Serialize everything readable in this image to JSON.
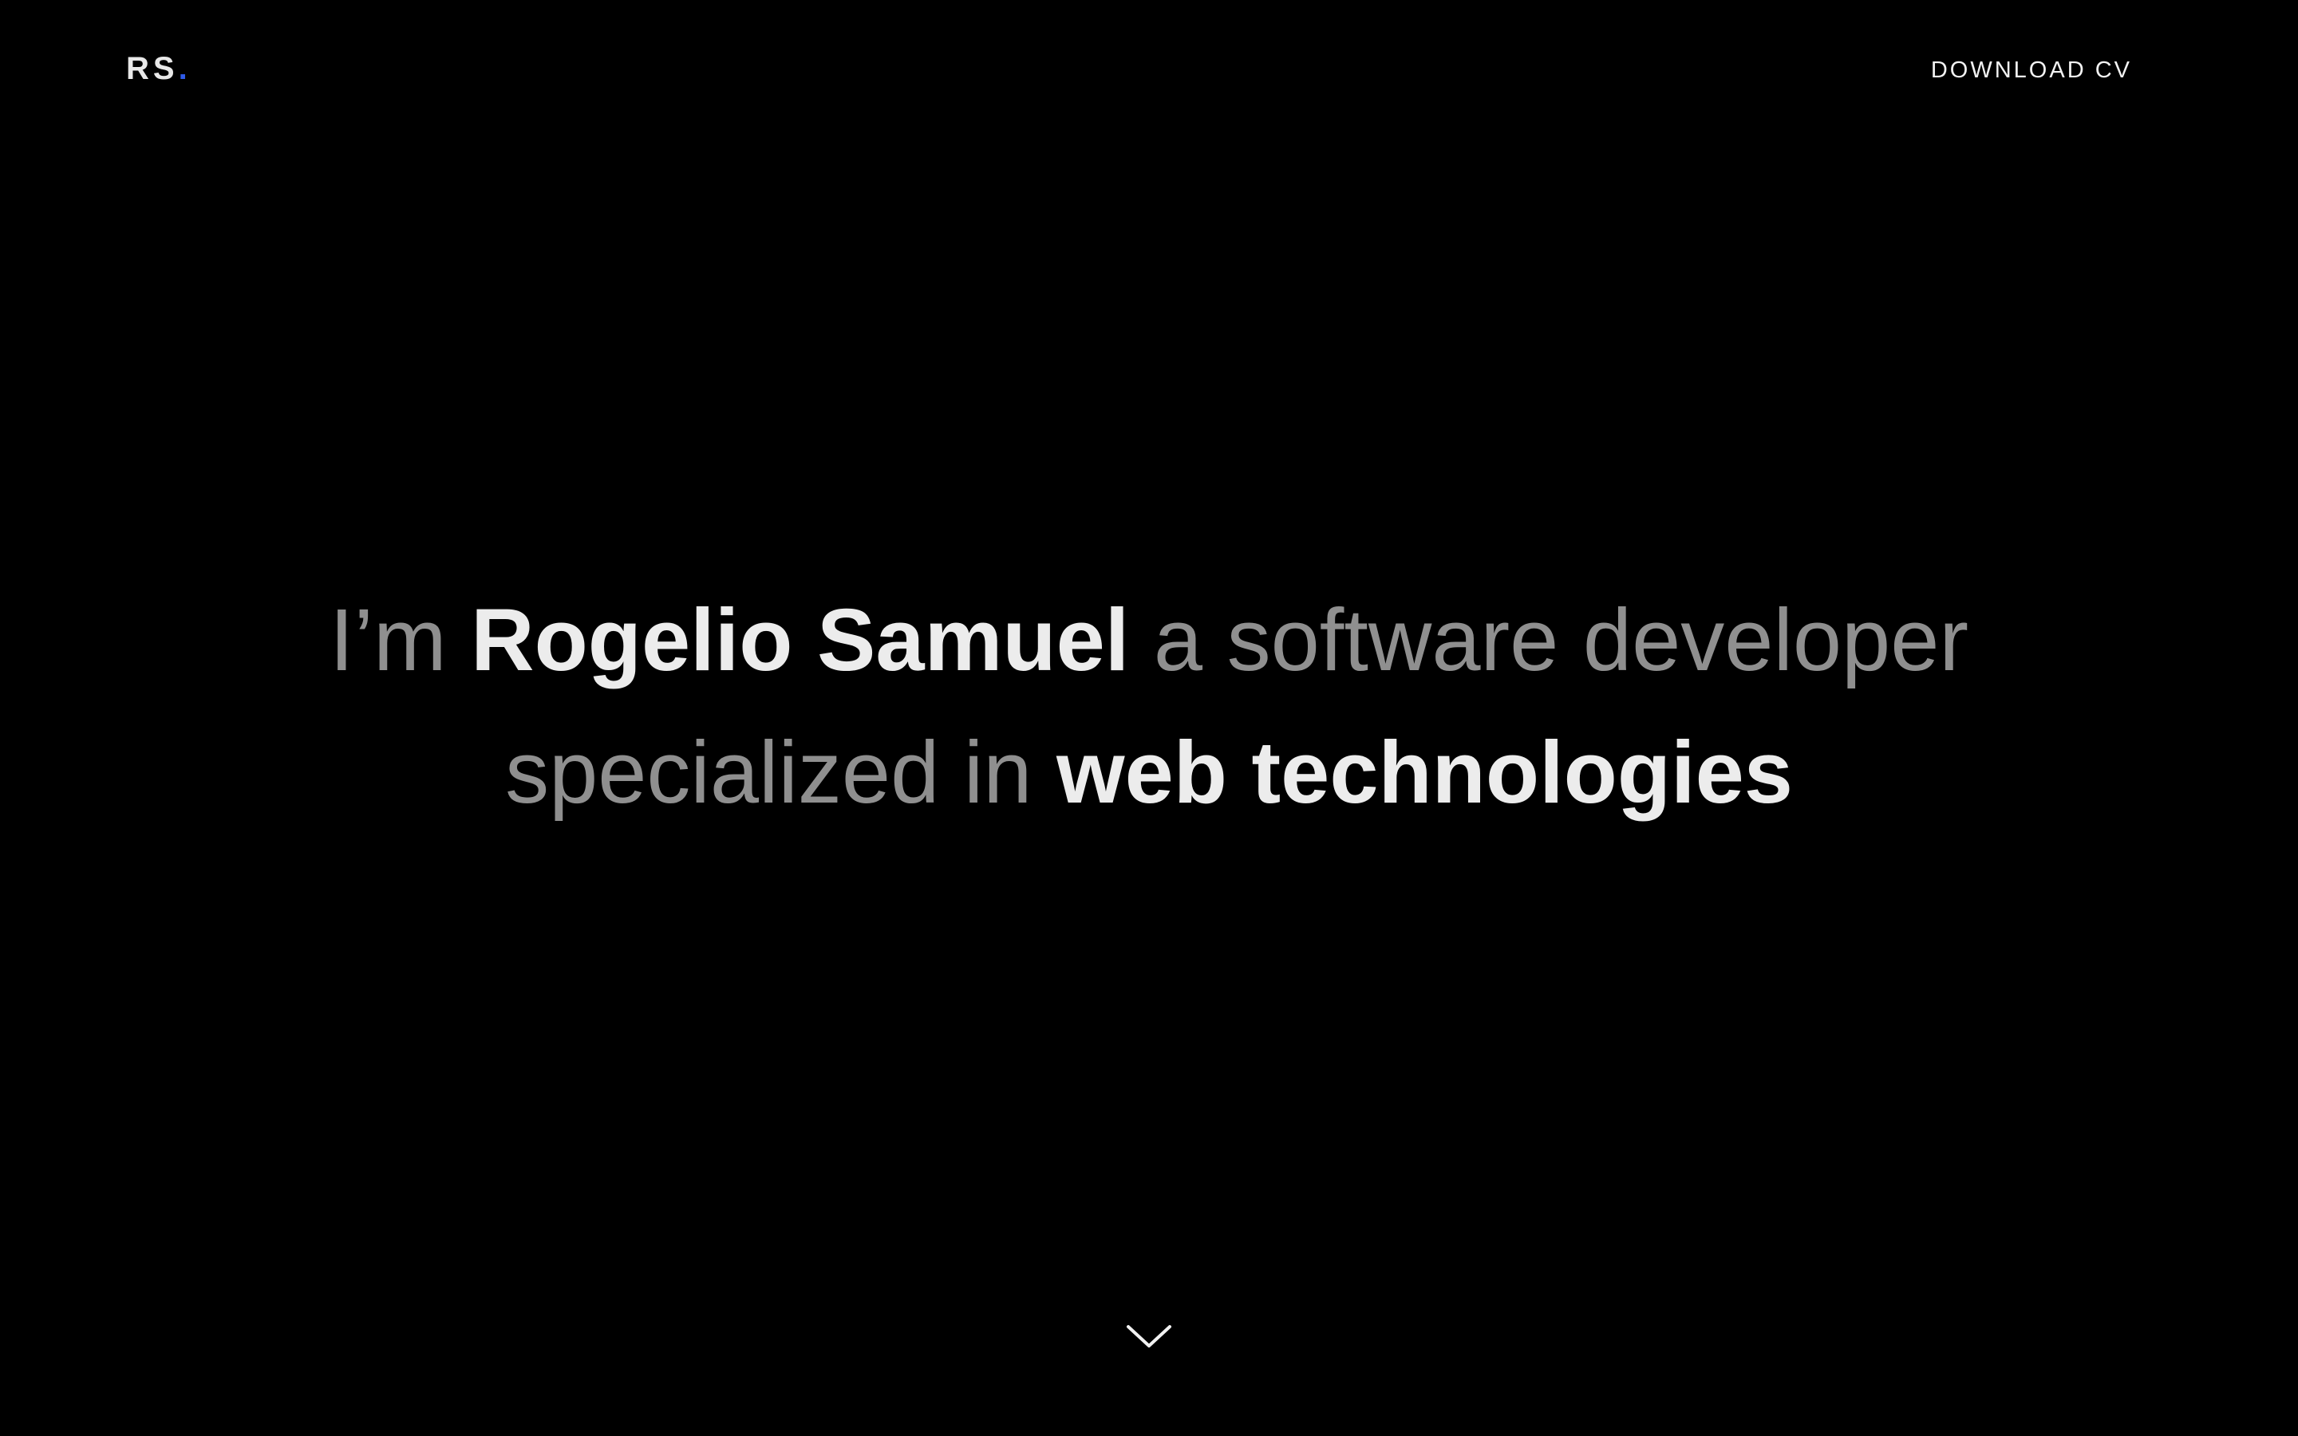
{
  "header": {
    "logo_text": "RS",
    "logo_dot": ".",
    "cta_label": "DOWNLOAD CV"
  },
  "hero": {
    "line1": {
      "prefix": "I’m",
      "name": "Rogelio Samuel",
      "suffix": "a software developer"
    },
    "line2": {
      "prefix": "specialized in",
      "highlight": "web technologies"
    }
  },
  "scroll": {
    "icon": "chevron-down-icon"
  },
  "colors": {
    "background": "#000000",
    "accent": "#2f5bea",
    "text_strong": "#ececec",
    "text_light": "#8f8f8f"
  }
}
